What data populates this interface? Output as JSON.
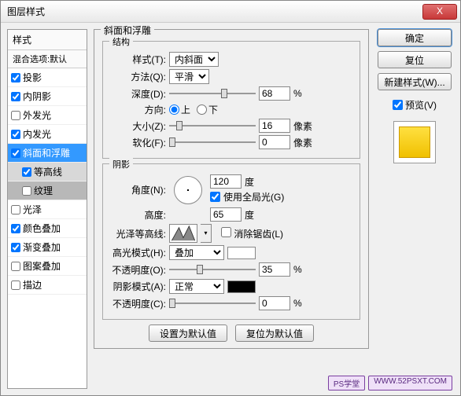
{
  "title": "图层样式",
  "close": "X",
  "left": {
    "header": "样式",
    "blend": "混合选项:默认",
    "items": [
      {
        "label": "投影",
        "checked": true
      },
      {
        "label": "内阴影",
        "checked": true
      },
      {
        "label": "外发光",
        "checked": false
      },
      {
        "label": "内发光",
        "checked": true
      },
      {
        "label": "斜面和浮雕",
        "checked": true,
        "selected": true
      },
      {
        "label": "等高线",
        "checked": true,
        "indent": true
      },
      {
        "label": "纹理",
        "checked": false,
        "indent": true,
        "sel2": true
      },
      {
        "label": "光泽",
        "checked": false
      },
      {
        "label": "颜色叠加",
        "checked": true
      },
      {
        "label": "渐变叠加",
        "checked": true
      },
      {
        "label": "图案叠加",
        "checked": false
      },
      {
        "label": "描边",
        "checked": false
      }
    ]
  },
  "main": {
    "group_title": "斜面和浮雕",
    "structure": {
      "title": "结构",
      "style_label": "样式(T):",
      "style_value": "内斜面",
      "method_label": "方法(Q):",
      "method_value": "平滑",
      "depth_label": "深度(D):",
      "depth_value": "68",
      "depth_unit": "%",
      "direction_label": "方向:",
      "up": "上",
      "down": "下",
      "size_label": "大小(Z):",
      "size_value": "16",
      "size_unit": "像素",
      "soften_label": "软化(F):",
      "soften_value": "0",
      "soften_unit": "像素"
    },
    "shading": {
      "title": "阴影",
      "angle_label": "角度(N):",
      "angle_value": "120",
      "angle_unit": "度",
      "global_label": "使用全局光(G)",
      "altitude_label": "高度:",
      "altitude_value": "65",
      "altitude_unit": "度",
      "gloss_label": "光泽等高线:",
      "antialias_label": "消除锯齿(L)",
      "highlight_mode_label": "高光模式(H):",
      "highlight_mode_value": "叠加",
      "highlight_opacity_label": "不透明度(O):",
      "highlight_opacity_value": "35",
      "opacity_unit": "%",
      "shadow_mode_label": "阴影模式(A):",
      "shadow_mode_value": "正常",
      "shadow_opacity_label": "不透明度(C):",
      "shadow_opacity_value": "0"
    },
    "defaults_btn": "设置为默认值",
    "reset_btn": "复位为默认值"
  },
  "right": {
    "ok": "确定",
    "reset": "复位",
    "new_style": "新建样式(W)...",
    "preview": "预览(V)"
  },
  "watermark": {
    "a": "PS学堂",
    "b": "WWW.52PSXT.COM"
  }
}
